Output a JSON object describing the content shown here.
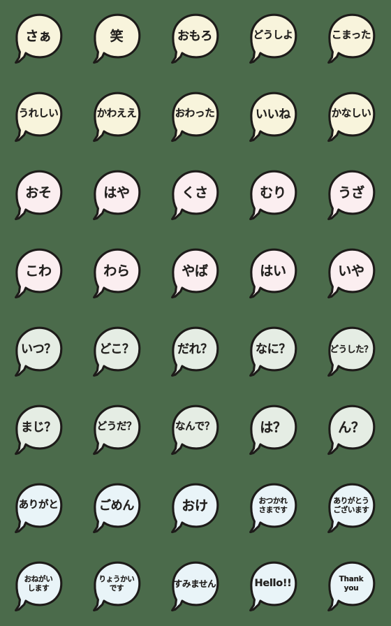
{
  "sheet": {
    "title": "Speech Bubble Emoji Sticker Sheet",
    "background_color": "#4b6b4b",
    "columns": 5,
    "rows": 8,
    "outline_color": "#1d1b19",
    "text_color": "#23211f"
  },
  "palettes": {
    "cream": "#f8f4dc",
    "pink": "#fbeef0",
    "mint": "#e5ede4",
    "ice": "#e9f4f8"
  },
  "rows": [
    {
      "row_index": 1,
      "fill_name": "cream",
      "fill": "#f8f4dc",
      "stickers": [
        {
          "text": "さぁ",
          "size": "t-xl"
        },
        {
          "text": "笑",
          "size": "t-xl"
        },
        {
          "text": "おもろ",
          "size": "t-lg"
        },
        {
          "text": "どうしよ",
          "size": "t-md"
        },
        {
          "text": "こまった",
          "size": "t-md"
        }
      ]
    },
    {
      "row_index": 2,
      "fill_name": "cream",
      "fill": "#f8f4dc",
      "stickers": [
        {
          "text": "うれしい",
          "size": "t-md"
        },
        {
          "text": "かわええ",
          "size": "t-md"
        },
        {
          "text": "おわった",
          "size": "t-md"
        },
        {
          "text": "いいね",
          "size": "t-lg"
        },
        {
          "text": "かなしい",
          "size": "t-md"
        }
      ]
    },
    {
      "row_index": 3,
      "fill_name": "pink",
      "fill": "#fbeef0",
      "stickers": [
        {
          "text": "おそ",
          "size": "t-xl"
        },
        {
          "text": "はや",
          "size": "t-xl"
        },
        {
          "text": "くさ",
          "size": "t-xl"
        },
        {
          "text": "むり",
          "size": "t-xl"
        },
        {
          "text": "うざ",
          "size": "t-xl"
        }
      ]
    },
    {
      "row_index": 4,
      "fill_name": "pink",
      "fill": "#fbeef0",
      "stickers": [
        {
          "text": "こわ",
          "size": "t-xl"
        },
        {
          "text": "わら",
          "size": "t-xl"
        },
        {
          "text": "やば",
          "size": "t-xl"
        },
        {
          "text": "はい",
          "size": "t-xl"
        },
        {
          "text": "いや",
          "size": "t-xl"
        }
      ]
    },
    {
      "row_index": 5,
      "fill_name": "mint",
      "fill": "#e5ede4",
      "stickers": [
        {
          "text": "いつ？",
          "size": "t-lg"
        },
        {
          "text": "どこ？",
          "size": "t-lg"
        },
        {
          "text": "だれ？",
          "size": "t-lg"
        },
        {
          "text": "なに？",
          "size": "t-lg"
        },
        {
          "text": "どうした？",
          "size": "t-sm"
        }
      ]
    },
    {
      "row_index": 6,
      "fill_name": "mint",
      "fill": "#e5ede4",
      "stickers": [
        {
          "text": "まじ？",
          "size": "t-lg"
        },
        {
          "text": "どうだ？",
          "size": "t-md"
        },
        {
          "text": "なんで？",
          "size": "t-md"
        },
        {
          "text": "は？",
          "size": "t-xl"
        },
        {
          "text": "ん？",
          "size": "t-xl"
        }
      ]
    },
    {
      "row_index": 7,
      "fill_name": "ice",
      "fill": "#e9f4f8",
      "stickers": [
        {
          "text": "ありがと",
          "size": "t-md"
        },
        {
          "text": "ごめん",
          "size": "t-lg"
        },
        {
          "text": "おけ",
          "size": "t-xl"
        },
        {
          "text": "おつかれ\nさまです",
          "size": "t-2line"
        },
        {
          "text": "ありがとう\nございます",
          "size": "t-2line"
        }
      ]
    },
    {
      "row_index": 8,
      "fill_name": "ice",
      "fill": "#e9f4f8",
      "stickers": [
        {
          "text": "おねがい\nします",
          "size": "t-2line"
        },
        {
          "text": "りょうかい\nです",
          "size": "t-2line"
        },
        {
          "text": "すみません",
          "size": "t-sm"
        },
        {
          "text": "Hello!!",
          "size": "t-md t-latin"
        },
        {
          "text": "Thank\nyou",
          "size": "t-2line t-latin"
        }
      ]
    }
  ]
}
